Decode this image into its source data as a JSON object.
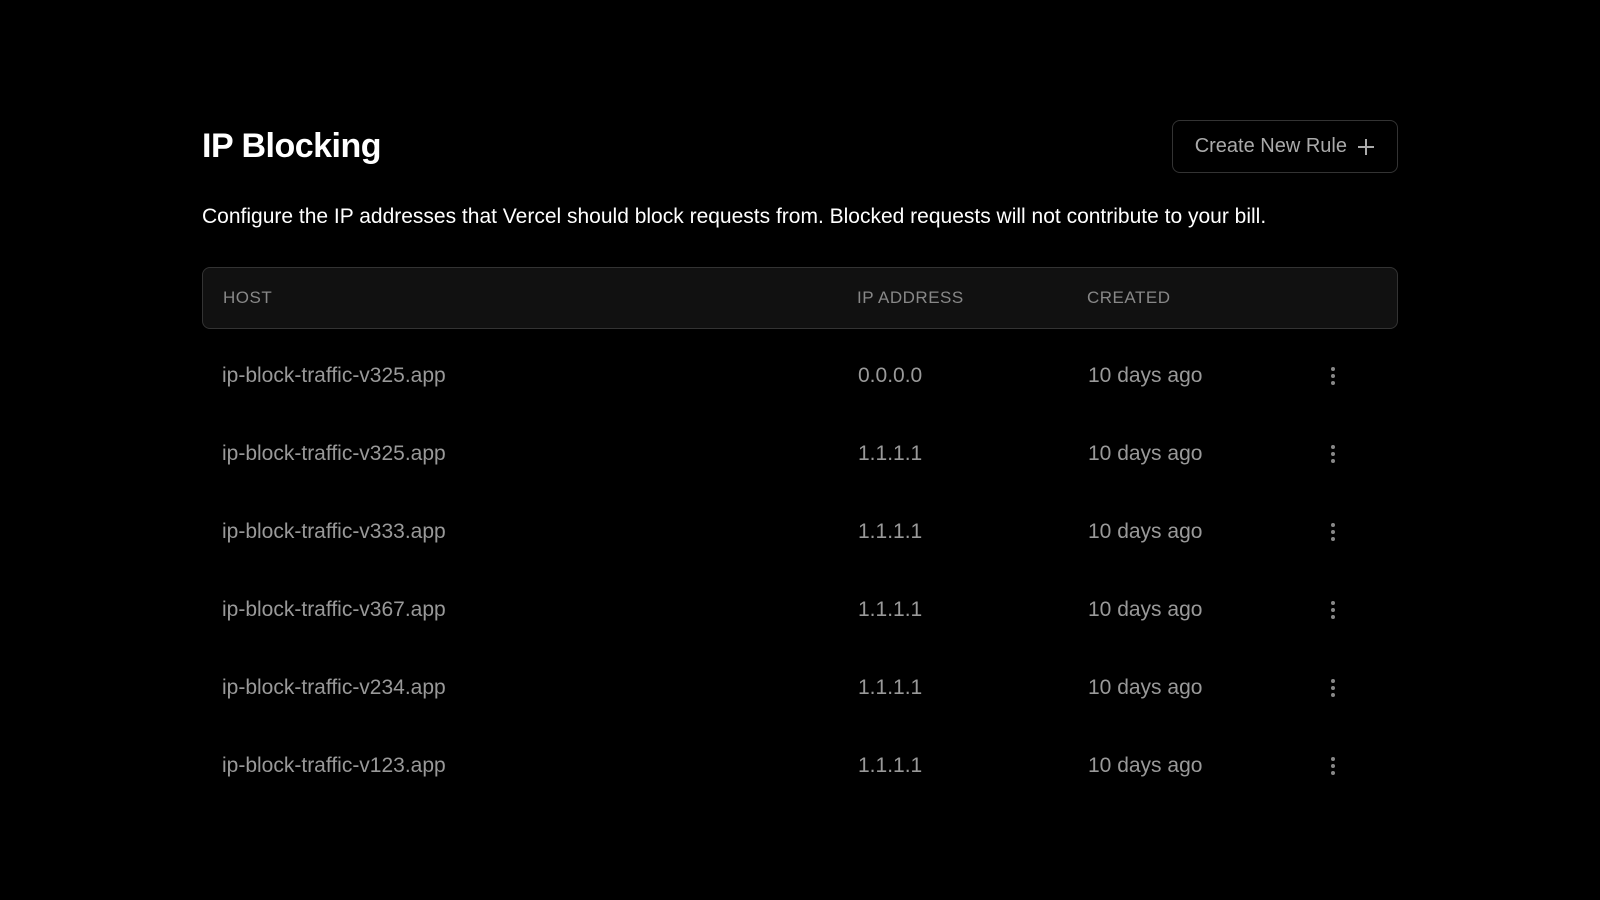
{
  "header": {
    "title": "IP Blocking",
    "create_button_label": "Create New Rule"
  },
  "description": "Configure the IP addresses that Vercel should block requests from. Blocked requests will not contribute to your bill.",
  "table": {
    "columns": {
      "host": "HOST",
      "ip_address": "IP ADDRESS",
      "created": "CREATED"
    },
    "rows": [
      {
        "host": "ip-block-traffic-v325.app",
        "ip_address": "0.0.0.0",
        "created": "10 days ago"
      },
      {
        "host": "ip-block-traffic-v325.app",
        "ip_address": "1.1.1.1",
        "created": "10 days ago"
      },
      {
        "host": "ip-block-traffic-v333.app",
        "ip_address": "1.1.1.1",
        "created": "10 days ago"
      },
      {
        "host": "ip-block-traffic-v367.app",
        "ip_address": "1.1.1.1",
        "created": "10 days ago"
      },
      {
        "host": "ip-block-traffic-v234.app",
        "ip_address": "1.1.1.1",
        "created": "10 days ago"
      },
      {
        "host": "ip-block-traffic-v123.app",
        "ip_address": "1.1.1.1",
        "created": "10 days ago"
      }
    ]
  }
}
